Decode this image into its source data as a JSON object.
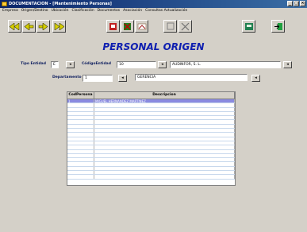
{
  "window": {
    "title": "DOCUMENTACION - [Mantenimiento Personas]"
  },
  "menu": [
    "Empresa",
    "Origen/Destino",
    "Ubicación",
    "Clasificación",
    "Documentos",
    "Asociación",
    "Consultas Actualización"
  ],
  "toolbar": {
    "icons": [
      "first-record-icon",
      "previous-record-icon",
      "next-record-icon",
      "last-record-icon",
      "new-record-icon",
      "delete-record-icon",
      "edit-record-icon",
      "save-icon",
      "cancel-icon",
      "print-icon",
      "exit-icon"
    ]
  },
  "page": {
    "title": "PERSONAL ORIGEN"
  },
  "form": {
    "tipo_entidad": {
      "label": "Tipo Entidad",
      "value": "E"
    },
    "codigo_entidad": {
      "label": "CódigoEntidad",
      "value": "10",
      "name": "AUDINFOR, S. L."
    },
    "departamento": {
      "label": "Departamento",
      "value": "1",
      "name": "GERENCIA"
    }
  },
  "grid": {
    "columns": [
      "CodPersona",
      "Descripcion"
    ],
    "rows": [
      {
        "code": "1",
        "desc": "MIGUEL HERNANDEZ MARTINEZ"
      }
    ]
  }
}
